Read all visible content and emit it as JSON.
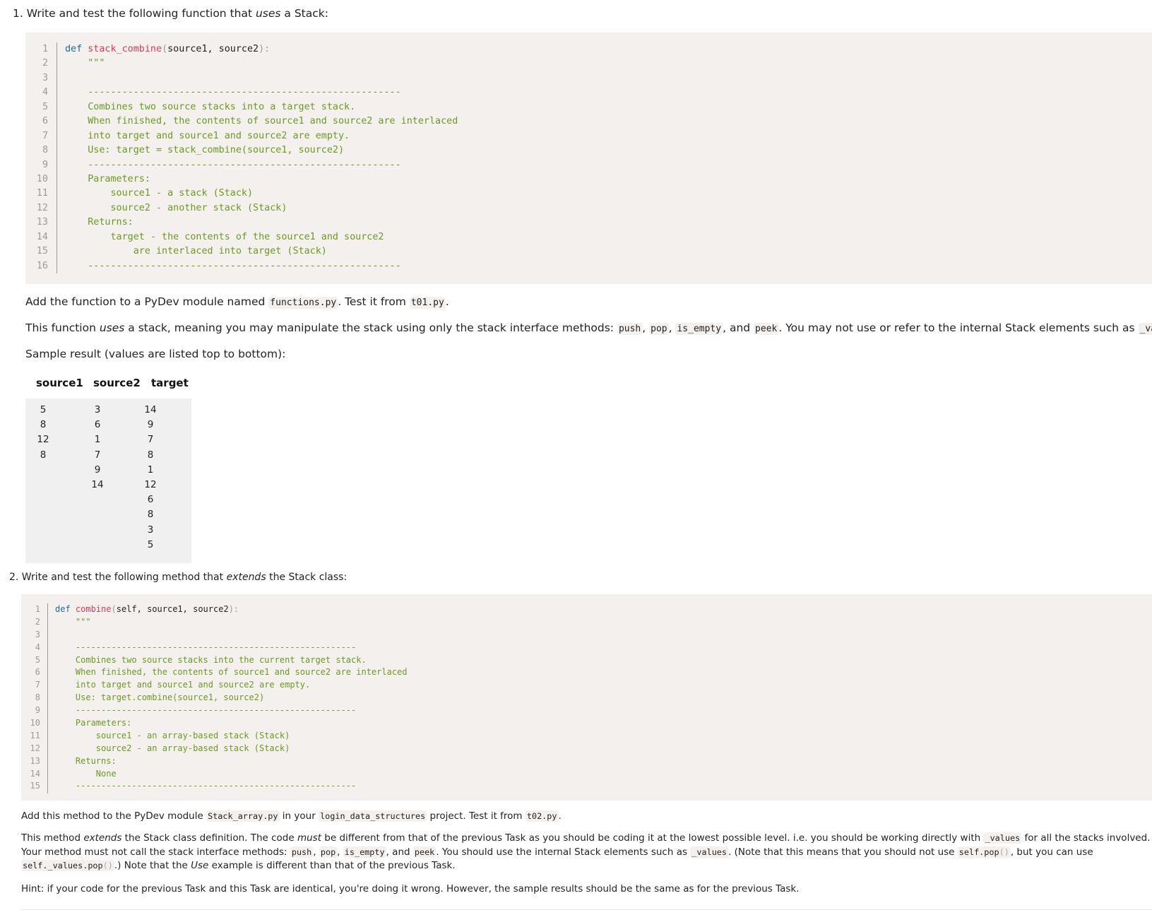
{
  "task1": {
    "heading_prefix": "1. Write and test the following function that ",
    "heading_em": "uses",
    "heading_suffix": " a Stack:",
    "code": {
      "keyword": "def",
      "func_name": "stack_combine",
      "open_paren": "(",
      "params": "source1, source2",
      "close": "):",
      "line_numbers": [
        "1",
        "2",
        "3",
        "4",
        "5",
        "6",
        "7",
        "8",
        "9",
        "10",
        "11",
        "12",
        "13",
        "14",
        "15",
        "16"
      ],
      "doc_lines": [
        "    \"\"\"",
        "",
        "    -------------------------------------------------------",
        "    Combines two source stacks into a target stack.",
        "    When finished, the contents of source1 and source2 are interlaced",
        "    into target and source1 and source2 are empty.",
        "    Use: target = stack_combine(source1, source2)",
        "    -------------------------------------------------------",
        "    Parameters:",
        "        source1 - a stack (Stack)",
        "        source2 - another stack (Stack)",
        "    Returns:",
        "        target - the contents of the source1 and source2",
        "            are interlaced into target (Stack)",
        "    -------------------------------------------------------",
        "    \"\"\""
      ]
    },
    "para1": {
      "t1": "Add the function to a PyDev module named ",
      "c1": "functions.py",
      "t2": ". Test it from ",
      "c2": "t01.py",
      "t3": "."
    },
    "para2": {
      "t1": "This function ",
      "em1": "uses",
      "t2": " a stack, meaning you may manipulate the stack using only the stack interface methods: ",
      "c1": "push",
      "t3": ", ",
      "c2": "pop",
      "t4": ", ",
      "c3": "is_empty",
      "t5": ", and ",
      "c4": "peek",
      "t6": ". You may not use or refer to the internal Stack elements such as ",
      "c5": "_values",
      "t7": "."
    },
    "para3": "Sample result (values are listed top to bottom):",
    "sample": {
      "headers": [
        "source1",
        "source2",
        "target"
      ],
      "source1": [
        "5",
        "8",
        "12",
        "8"
      ],
      "source2": [
        "3",
        "6",
        "1",
        "7",
        "9",
        "14"
      ],
      "target": [
        "14",
        "9",
        "7",
        "8",
        "1",
        "12",
        "6",
        "8",
        "3",
        "5"
      ]
    }
  },
  "task2": {
    "heading_prefix": "2. Write and test the following method that ",
    "heading_em": "extends",
    "heading_suffix": " the Stack class:",
    "code": {
      "keyword": "def",
      "func_name": "combine",
      "open_paren": "(",
      "params": "self, source1, source2",
      "close": "):",
      "line_numbers": [
        "1",
        "2",
        "3",
        "4",
        "5",
        "6",
        "7",
        "8",
        "9",
        "10",
        "11",
        "12",
        "13",
        "14",
        "15"
      ],
      "doc_lines": [
        "    \"\"\"",
        "",
        "    -------------------------------------------------------",
        "    Combines two source stacks into the current target stack.",
        "    When finished, the contents of source1 and source2 are interlaced",
        "    into target and source1 and source2 are empty.",
        "    Use: target.combine(source1, source2)",
        "    -------------------------------------------------------",
        "    Parameters:",
        "        source1 - an array-based stack (Stack)",
        "        source2 - an array-based stack (Stack)",
        "    Returns:",
        "        None",
        "    -------------------------------------------------------",
        "    \"\"\""
      ]
    },
    "para1": {
      "t1": "Add this method to the PyDev module ",
      "c1": "Stack_array.py",
      "t2": " in your ",
      "c2": "login_data_structures",
      "t3": " project. Test it from ",
      "c3": "t02.py",
      "t4": "."
    },
    "para2": {
      "t1": "This method ",
      "em1": "extends",
      "t2": " the Stack class definition. The code ",
      "em2": "must",
      "t3": " be different from that of the previous Task as you should be coding it at the lowest possible level. i.e. you should be working directly with ",
      "c1": "_values",
      "t4": " for all the stacks involved. Your method must not call the stack interface methods: ",
      "c2": "push",
      "t5": ", ",
      "c3": "pop",
      "t6": ", ",
      "c4": "is_empty",
      "t7": ", and ",
      "c5": "peek",
      "t8": ". You should use the internal Stack elements such as ",
      "c6": "_values",
      "t9": ". (Note that this means that you should not use ",
      "c7a": "self.pop",
      "c7b": "()",
      "t10": ", but you can use ",
      "c8a": "self._values.pop",
      "c8b": "()",
      "t11": ".) Note that the ",
      "em3": "Use",
      "t12": " example is different than that of the previous Task."
    },
    "hint": "Hint: if your code for the previous Task and this Task are identical, you're doing it wrong. However, the sample results should be the same as for the previous Task."
  },
  "colors": {
    "code_bg": "#f4f0ed",
    "keyword": "#1d6aa0",
    "function": "#dc3a5a",
    "docstring": "#6a9a1e",
    "line_number": "#9a9a9a",
    "table_bg": "#f0f0f0"
  }
}
